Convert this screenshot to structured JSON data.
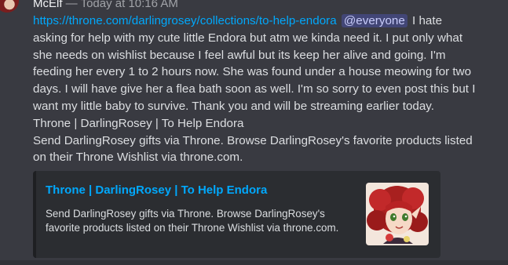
{
  "message": {
    "username": "McElf",
    "timestamp": "— Today at 10:16 AM",
    "link_text": "https://throne.com/darlingrosey/collections/to-help-endora",
    "mention": "@everyone",
    "line1_rest": "I hate",
    "lines": [
      "asking for help with my cute little Endora but atm we kinda need it. I put only what",
      "she needs on wishlist because I feel awful but its keep her alive and going. I'm",
      "feeding her every 1 to 2 hours now. She was found under a house meowing for two",
      "days. I will have give her a flea bath soon as well. I'm so sorry to even post this but I",
      "want my little baby to survive. Thank you and will be streaming earlier today.",
      "Throne | DarlingRosey | To Help Endora",
      "Send DarlingRosey gifts via Throne. Browse DarlingRosey's favorite products listed",
      "on their Throne Wishlist via throne.com."
    ]
  },
  "embed": {
    "title": "Throne | DarlingRosey | To Help Endora",
    "description": "Send DarlingRosey gifts via Throne. Browse DarlingRosey's favorite products listed on their Throne Wishlist via throne.com.",
    "thumbnail": "anime-girl-red-hair-thumbnail"
  },
  "colors": {
    "background": "#393a41",
    "link": "#00a8fc",
    "embed_bg": "#2b2d31"
  }
}
